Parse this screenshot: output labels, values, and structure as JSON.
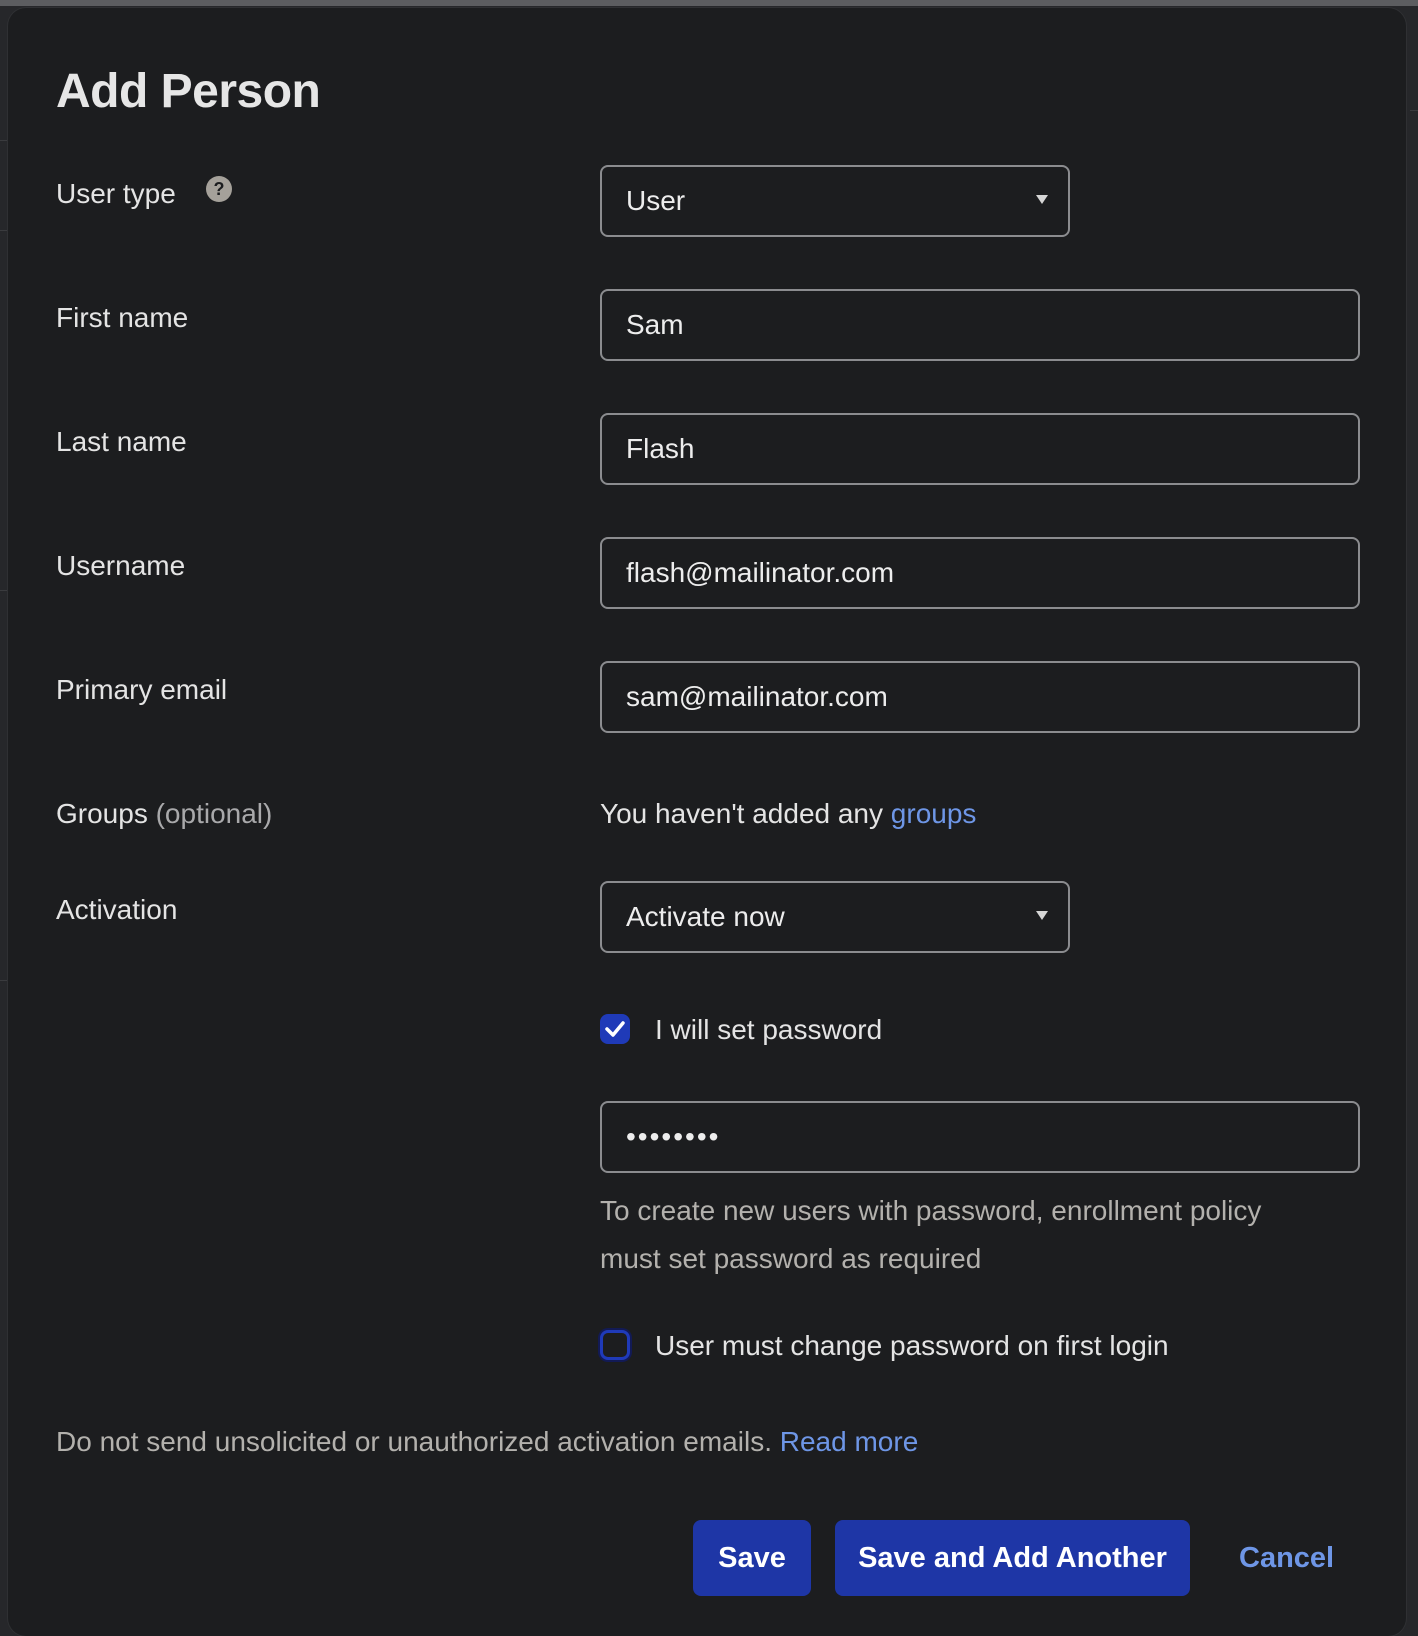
{
  "dialog": {
    "title": "Add Person"
  },
  "form": {
    "user_type": {
      "label": "User type",
      "value": "User"
    },
    "first_name": {
      "label": "First name",
      "value": "Sam"
    },
    "last_name": {
      "label": "Last name",
      "value": "Flash"
    },
    "username": {
      "label": "Username",
      "value": "flash@mailinator.com"
    },
    "primary_email": {
      "label": "Primary email",
      "value": "sam@mailinator.com"
    },
    "groups": {
      "label": "Groups",
      "optional": "(optional)",
      "empty_text": "You haven't added any",
      "link": "groups"
    },
    "activation": {
      "label": "Activation",
      "value": "Activate now"
    },
    "set_password": {
      "label": "I will set password",
      "checked": true
    },
    "password": {
      "value": "••••••••"
    },
    "password_hint": {
      "line1": "To create new users with password, enrollment policy",
      "line2": "must set password as required"
    },
    "change_password": {
      "label": "User must change password on first login",
      "checked": false
    }
  },
  "notice": {
    "text": "Do not send unsolicited or unauthorized activation emails.",
    "link": "Read more"
  },
  "actions": {
    "save": "Save",
    "save_another": "Save and Add Another",
    "cancel": "Cancel"
  },
  "colors": {
    "primary_button": "#1e36a6",
    "link": "#6e96e6",
    "background": "#1c1d1f"
  }
}
